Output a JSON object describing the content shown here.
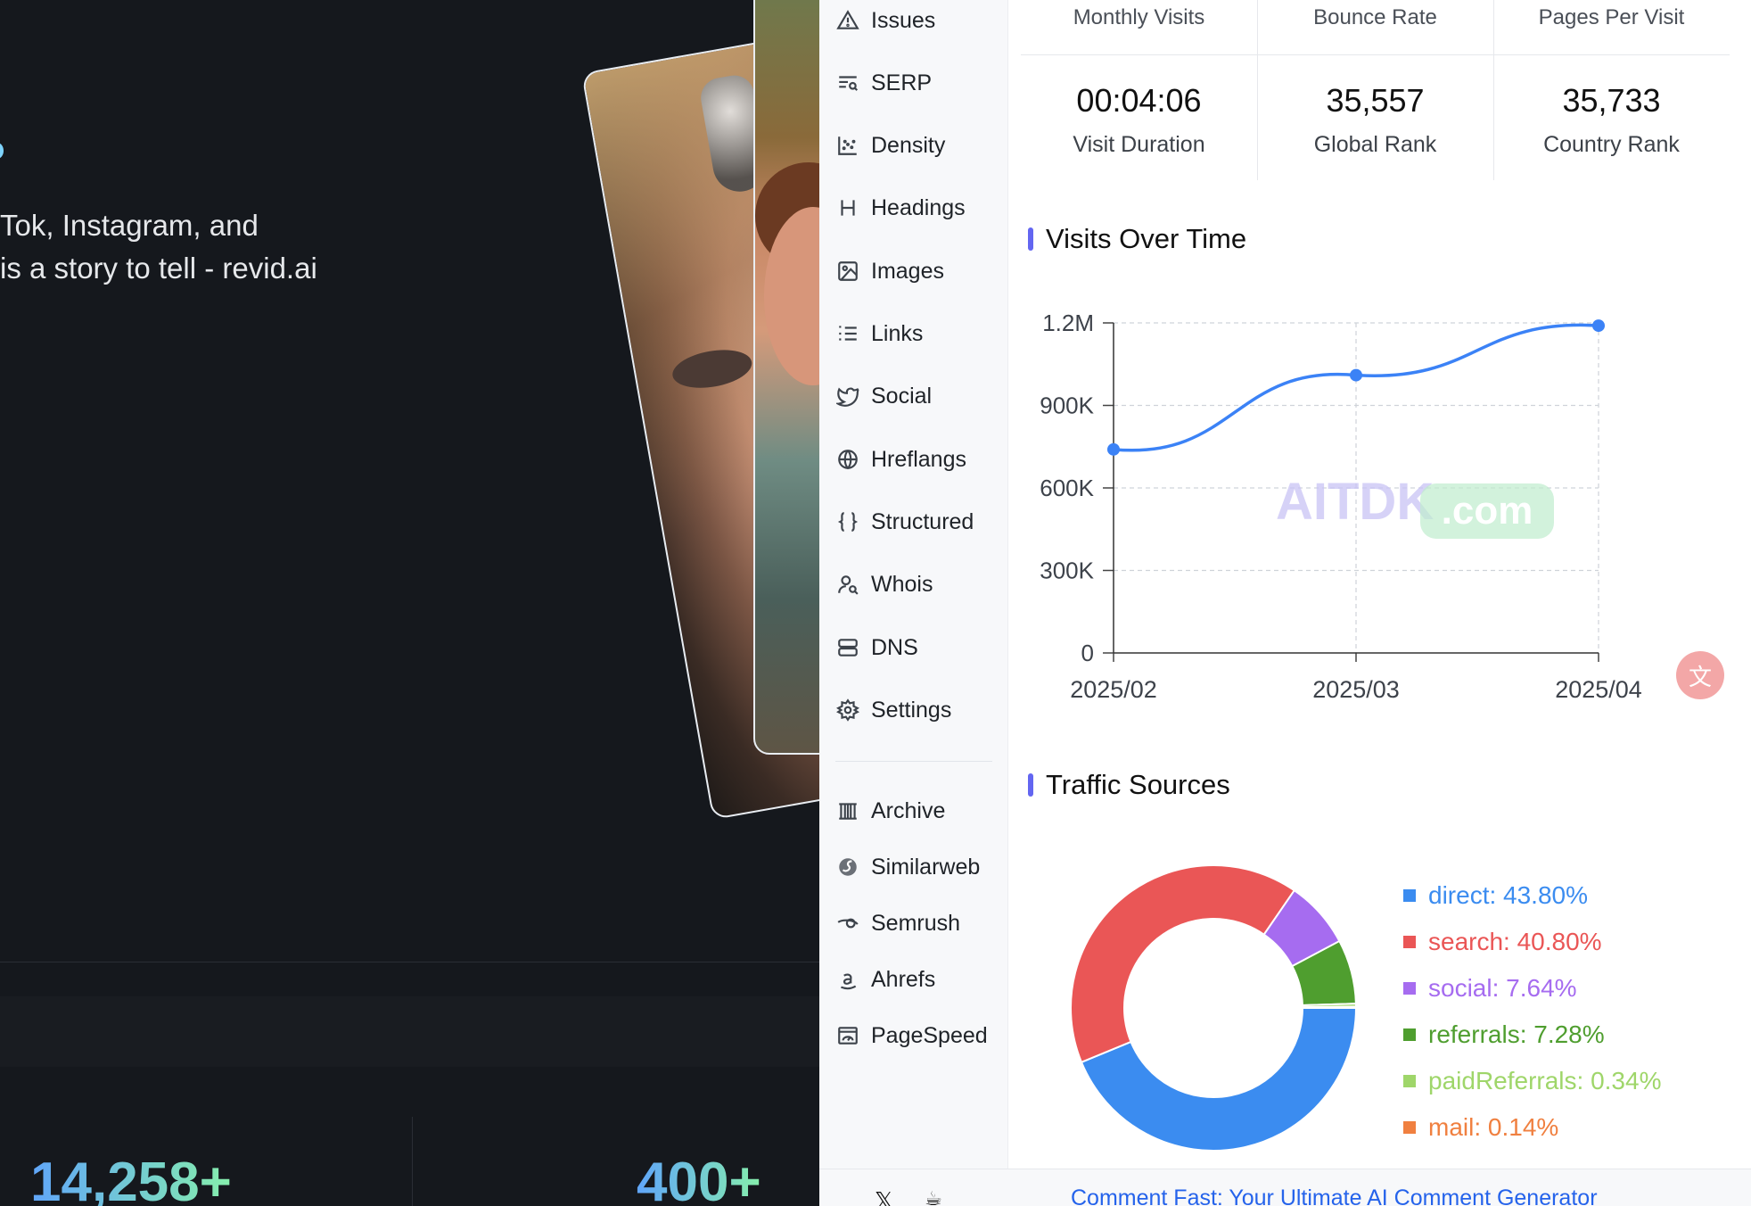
{
  "website": {
    "hero_line_1": "Tok, Instagram, and",
    "hero_line_2": "is a story to tell - revid.ai",
    "stats": [
      "14,258+",
      "400+"
    ]
  },
  "sidebar": {
    "items": [
      {
        "label": "Issues",
        "icon": "warning-icon"
      },
      {
        "label": "SERP",
        "icon": "serp-icon"
      },
      {
        "label": "Density",
        "icon": "density-icon"
      },
      {
        "label": "Headings",
        "icon": "heading-icon"
      },
      {
        "label": "Images",
        "icon": "image-icon"
      },
      {
        "label": "Links",
        "icon": "list-icon"
      },
      {
        "label": "Social",
        "icon": "twitter-icon"
      },
      {
        "label": "Hreflangs",
        "icon": "globe-icon"
      },
      {
        "label": "Structured",
        "icon": "braces-icon"
      },
      {
        "label": "Whois",
        "icon": "user-search-icon"
      },
      {
        "label": "DNS",
        "icon": "server-icon"
      },
      {
        "label": "Settings",
        "icon": "gear-icon"
      }
    ],
    "external": [
      {
        "label": "Archive",
        "icon": "archive-icon"
      },
      {
        "label": "Similarweb",
        "icon": "similarweb-icon"
      },
      {
        "label": "Semrush",
        "icon": "semrush-icon"
      },
      {
        "label": "Ahrefs",
        "icon": "ahrefs-icon"
      },
      {
        "label": "PageSpeed",
        "icon": "pagespeed-icon"
      }
    ]
  },
  "stats_table": {
    "headers": [
      "Monthly Visits",
      "Bounce Rate",
      "Pages Per Visit"
    ],
    "values": [
      "00:04:06",
      "35,557",
      "35,733"
    ],
    "labels": [
      "Visit Duration",
      "Global Rank",
      "Country Rank"
    ]
  },
  "visits_title": "Visits Over Time",
  "traffic_title": "Traffic Sources",
  "watermark": {
    "text": "AITDK",
    "suffix": ".com"
  },
  "bottom": {
    "link": "Comment Fast: Your Ultimate AI Comment Generator"
  },
  "chart_data": [
    {
      "type": "line",
      "title": "Visits Over Time",
      "x": [
        "2025/02",
        "2025/03",
        "2025/04"
      ],
      "series": [
        {
          "values": [
            740000,
            1010000,
            1190000
          ]
        }
      ],
      "yticks": [
        "0",
        "300K",
        "600K",
        "900K",
        "1.2M"
      ],
      "ylim": [
        0,
        1200000
      ],
      "grid": true,
      "color": "#3b82f6"
    },
    {
      "type": "pie",
      "title": "Traffic Sources",
      "donut": true,
      "legend": "right",
      "slices": [
        {
          "label": "direct: 43.80%",
          "name": "direct",
          "value": 43.8,
          "color": "#3b8cf0"
        },
        {
          "label": "search: 40.80%",
          "name": "search",
          "value": 40.8,
          "color": "#ea5656"
        },
        {
          "label": "social: 7.64%",
          "name": "social",
          "value": 7.64,
          "color": "#a66cf0"
        },
        {
          "label": "referrals: 7.28%",
          "name": "referrals",
          "value": 7.28,
          "color": "#4f9e2f"
        },
        {
          "label": "paidReferrals: 0.34%",
          "name": "paidReferrals",
          "value": 0.34,
          "color": "#9fd66a"
        },
        {
          "label": "mail: 0.14%",
          "name": "mail",
          "value": 0.14,
          "color": "#f08040"
        }
      ]
    }
  ]
}
